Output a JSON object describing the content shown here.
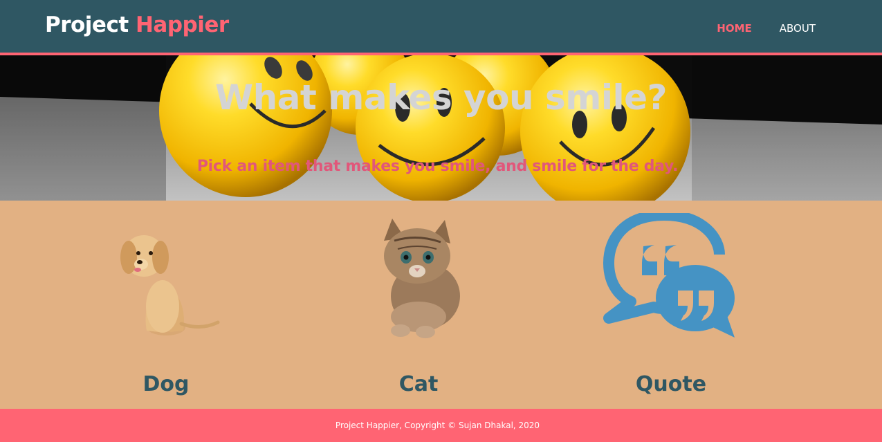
{
  "navbar": {
    "brand_primary": "Project",
    "brand_accent": "Happier",
    "links": [
      {
        "label": "HOME",
        "active": true
      },
      {
        "label": "ABOUT",
        "active": false
      }
    ]
  },
  "hero": {
    "title": "What makes you smile?",
    "subtitle": "Pick an item that makes you smile, and smile for the day.",
    "image": "smiley-balls-photo"
  },
  "choices": [
    {
      "label": "Dog",
      "image": "puppy-photo"
    },
    {
      "label": "Cat",
      "image": "kitten-photo"
    },
    {
      "label": "Quote",
      "image": "quote-bubbles-icon"
    }
  ],
  "footer": {
    "text": "Project Happier, Copyright © Sujan Dhakal, 2020"
  },
  "colors": {
    "navbar_bg": "#2f5763",
    "accent": "#ff6473",
    "content_bg": "#e2b183",
    "label_text": "#2f5763",
    "quote_icon": "#4593c4"
  }
}
